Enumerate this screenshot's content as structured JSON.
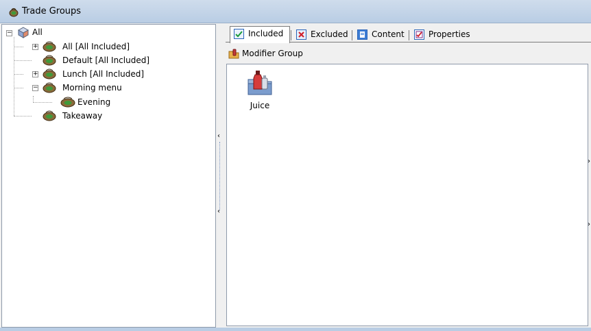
{
  "window": {
    "title": "Trade Groups"
  },
  "tree": {
    "root": {
      "label": "All",
      "expander": "−"
    },
    "items": [
      {
        "label": "All [All Included]",
        "expander": "+"
      },
      {
        "label": "Default [All Included]"
      },
      {
        "label": "Lunch [All Included]",
        "expander": "+"
      },
      {
        "label": "Morning menu",
        "expander": "−"
      },
      {
        "label": "Evening",
        "selected": false
      },
      {
        "label": "Takeaway"
      }
    ]
  },
  "tabs": [
    {
      "label": "Included",
      "icon": "check-icon",
      "active": true
    },
    {
      "label": "Excluded",
      "icon": "x-icon"
    },
    {
      "label": "Content",
      "icon": "content-icon"
    },
    {
      "label": "Properties",
      "icon": "properties-icon"
    }
  ],
  "breadcrumb": {
    "label": "Modifier Group",
    "icon": "modifier-group-icon"
  },
  "content": {
    "items": [
      {
        "label": "Juice",
        "icon": "bottle-folder-icon"
      }
    ]
  },
  "splitter": {
    "arrow": "‹"
  },
  "edge": {
    "arrow": "›"
  },
  "colors": {
    "titlebar": "#b9cde4",
    "accent": "#1f6fd1"
  }
}
